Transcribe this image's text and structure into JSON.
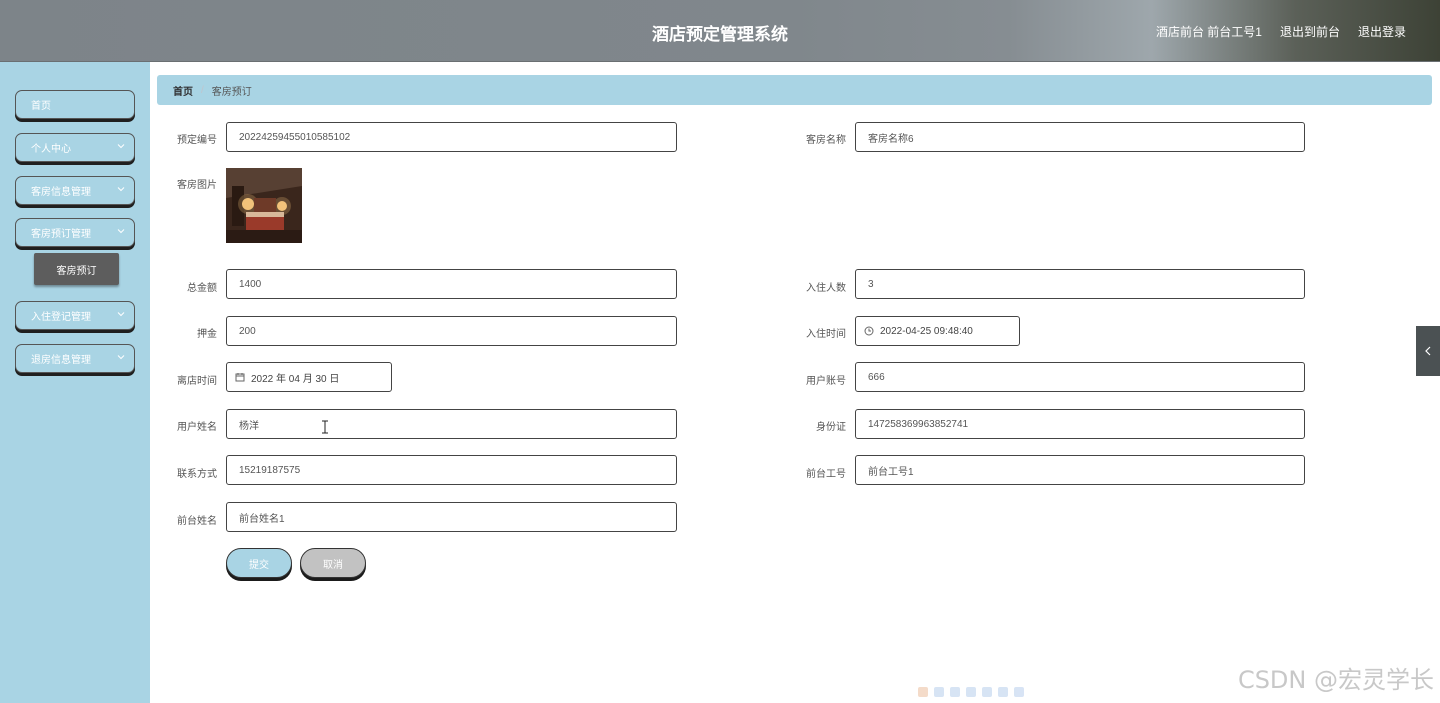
{
  "header": {
    "title": "酒店预定管理系统",
    "user_info": "酒店前台 前台工号1",
    "back_to_front": "退出到前台",
    "logout": "退出登录"
  },
  "sidebar": {
    "items": [
      {
        "label": "首页",
        "has_chevron": false
      },
      {
        "label": "个人中心",
        "has_chevron": true
      },
      {
        "label": "客房信息管理",
        "has_chevron": true
      },
      {
        "label": "客房预订管理",
        "has_chevron": true
      },
      {
        "label": "入住登记管理",
        "has_chevron": true
      },
      {
        "label": "退房信息管理",
        "has_chevron": true
      }
    ],
    "active_sub_item": "客房预订"
  },
  "breadcrumb": {
    "home": "首页",
    "separator": "/",
    "current": "客房预订"
  },
  "form": {
    "booking_no": {
      "label": "预定编号",
      "value": "20224259455010585102"
    },
    "room_name": {
      "label": "客房名称",
      "value": "客房名称6"
    },
    "room_image": {
      "label": "客房图片"
    },
    "total_amount": {
      "label": "总金额",
      "value": "1400"
    },
    "guest_count": {
      "label": "入住人数",
      "value": "3"
    },
    "deposit": {
      "label": "押金",
      "value": "200"
    },
    "checkin_time": {
      "label": "入住时间",
      "value": "2022-04-25 09:48:40"
    },
    "checkout_time": {
      "label": "离店时间",
      "value": "2022 年 04 月 30 日"
    },
    "user_account": {
      "label": "用户账号",
      "value": "666"
    },
    "user_name": {
      "label": "用户姓名",
      "value": "杨洋"
    },
    "id_card": {
      "label": "身份证",
      "value": "147258369963852741"
    },
    "contact": {
      "label": "联系方式",
      "value": "15219187575"
    },
    "front_desk_no": {
      "label": "前台工号",
      "value": "前台工号1"
    },
    "front_desk_name": {
      "label": "前台姓名",
      "value": "前台姓名1"
    },
    "submit_label": "提交",
    "cancel_label": "取消"
  },
  "watermark": "CSDN @宏灵学长",
  "colors": {
    "sidebar_bg": "#a9d4e4",
    "submenu_active": "#5d5d5d",
    "cancel_btn": "#c2c2c2"
  }
}
